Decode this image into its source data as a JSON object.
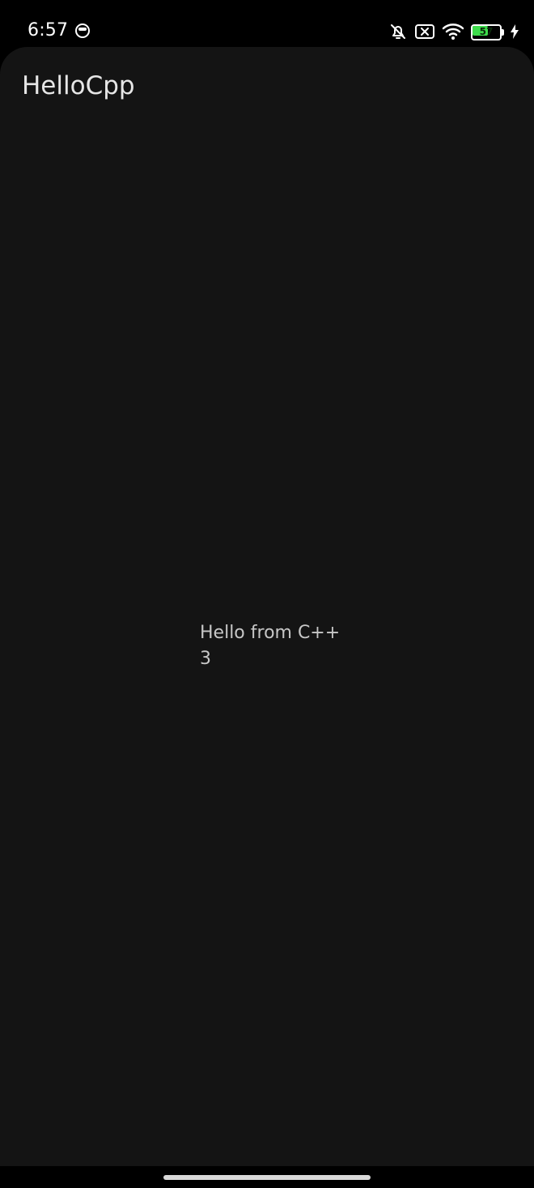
{
  "status_bar": {
    "time": "6:57",
    "left_icon": "app-notification-icon",
    "icons": [
      "bell-off-icon",
      "sim-blocked-icon",
      "wifi-icon",
      "battery-icon",
      "charging-bolt-icon"
    ],
    "battery_percent": "57",
    "battery_level": 0.57,
    "battery_color": "#3ddc4b"
  },
  "app": {
    "title": "HelloCpp",
    "content": {
      "line1": "Hello from C++",
      "line2": "3"
    }
  },
  "colors": {
    "background": "#141414",
    "title": "#e6e6e6",
    "text": "#c7c7c7"
  }
}
